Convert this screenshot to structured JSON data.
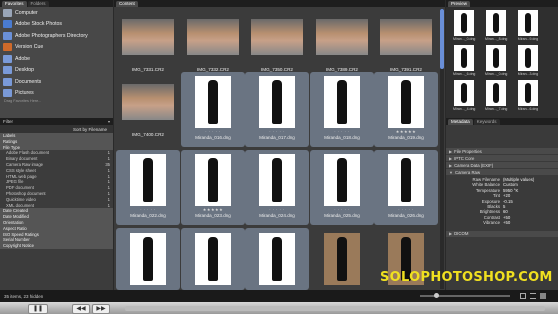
{
  "favorites": {
    "tabs": [
      "Favorites",
      "Folders"
    ],
    "items": [
      {
        "label": "Computer",
        "icon": "computer-icon",
        "color": "#9aa6b8"
      },
      {
        "label": "Adobe Stock Photos",
        "icon": "stock-photos-icon",
        "color": "#4a7bd0"
      },
      {
        "label": "Adobe Photographers Directory",
        "icon": "directory-icon",
        "color": "#6a90d8"
      },
      {
        "label": "Version Cue",
        "icon": "version-cue-icon",
        "color": "#d06a2a"
      },
      {
        "label": "Adobe",
        "icon": "folder-icon",
        "color": "#7a9ad8"
      },
      {
        "label": "Desktop",
        "icon": "desktop-icon",
        "color": "#7a9ad8"
      },
      {
        "label": "Documents",
        "icon": "documents-icon",
        "color": "#7a9ad8"
      },
      {
        "label": "Pictures",
        "icon": "pictures-icon",
        "color": "#7a9ad8"
      }
    ],
    "hint": "Drag Favorites Here..."
  },
  "filter": {
    "tab": "Filter",
    "sort_label": "Sort by Filename",
    "rows": [
      {
        "label": "Labels",
        "count": "",
        "cat": true
      },
      {
        "label": "Ratings",
        "count": "",
        "cat": true
      },
      {
        "label": "File Type",
        "count": "",
        "cat": true
      },
      {
        "label": "Adobe Flash document",
        "count": "1",
        "cat": false
      },
      {
        "label": "Binary document",
        "count": "1",
        "cat": false
      },
      {
        "label": "Camera Raw image",
        "count": "35",
        "cat": false
      },
      {
        "label": "CSS style sheet",
        "count": "1",
        "cat": false
      },
      {
        "label": "HTML web page",
        "count": "1",
        "cat": false
      },
      {
        "label": "JPEG file",
        "count": "1",
        "cat": false
      },
      {
        "label": "PDF document",
        "count": "1",
        "cat": false
      },
      {
        "label": "Photoshop document",
        "count": "1",
        "cat": false
      },
      {
        "label": "Quicktime video",
        "count": "1",
        "cat": false
      },
      {
        "label": "XML document",
        "count": "1",
        "cat": false
      },
      {
        "label": "Date Created",
        "count": "",
        "cat": true
      },
      {
        "label": "Date Modified",
        "count": "",
        "cat": true
      },
      {
        "label": "Orientation",
        "count": "",
        "cat": true
      },
      {
        "label": "Aspect Ratio",
        "count": "",
        "cat": true
      },
      {
        "label": "ISO Speed Ratings",
        "count": "",
        "cat": true
      },
      {
        "label": "Serial Number",
        "count": "",
        "cat": true
      },
      {
        "label": "Copyright Notice",
        "count": "",
        "cat": true
      }
    ]
  },
  "content": {
    "tab": "Content",
    "row1": [
      "IMG_7331.CR2",
      "IMG_7332.CR2",
      "IMG_7350.CR2",
      "IMG_7389.CR2",
      "IMG_7391.CR2"
    ],
    "row2": [
      {
        "name": "IMG_7400.CR2",
        "stars": ""
      },
      {
        "name": "Miranda_016.dng",
        "stars": "· · · · ·"
      },
      {
        "name": "Miranda_017.dng",
        "stars": "· · · · ·"
      },
      {
        "name": "Miranda_018.dng",
        "stars": "· · · · ·"
      },
      {
        "name": "Miranda_019.dng",
        "stars": "★★★★★"
      }
    ],
    "row3": [
      {
        "name": "Miranda_022.dng",
        "stars": "· · · · ·"
      },
      {
        "name": "Miranda_023.dng",
        "stars": "★★★★★"
      },
      {
        "name": "Miranda_024.dng",
        "stars": "· · · · ·"
      },
      {
        "name": "Miranda_025.dng",
        "stars": "· · · · ·"
      },
      {
        "name": "Miranda_026.dng",
        "stars": "· · · · ·"
      }
    ]
  },
  "preview": {
    "tab": "Preview",
    "captions": [
      "Miran..._0.dng",
      "Miran..._8.dng",
      "Miran...9.dng",
      "Miran..._6.dng",
      "Miran..._0.dng",
      "Miran...3.dng",
      "Miran..._4.dng",
      "Miran..._7.dng",
      "Miran...6.dng"
    ]
  },
  "metadata": {
    "tabs": [
      "Metadata",
      "Keywords"
    ],
    "sections": [
      "File Properties",
      "IPTC Core",
      "Camera Data (EXIF)"
    ],
    "camera_raw_title": "Camera Raw",
    "camera_raw": [
      {
        "k": "Raw Filename",
        "v": "(Multiple values)"
      },
      {
        "k": "White Balance",
        "v": "Custom"
      },
      {
        "k": "Temperature",
        "v": "5950 °K"
      },
      {
        "k": "Tint",
        "v": "+20"
      },
      {
        "k": "Exposure",
        "v": "-0.15"
      },
      {
        "k": "Blacks",
        "v": "5"
      },
      {
        "k": "Brightness",
        "v": "60"
      },
      {
        "k": "Contrast",
        "v": "+50"
      },
      {
        "k": "Vibrance",
        "v": "+50"
      }
    ],
    "dicom": "DICOM"
  },
  "status": {
    "items_text": "35 items, 23 hidden"
  },
  "watermark": "SOLOPHOTOSHOP.COM"
}
